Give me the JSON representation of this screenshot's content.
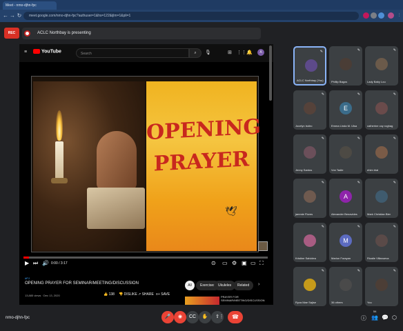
{
  "browser": {
    "tab_title": "Meet - nmo-djhn-fpc",
    "url": "meet.google.com/nmo-djhn-fpc?authuser=1&hs=122&ijlm=1&pli=1",
    "nav_back": "←",
    "nav_forward": "→",
    "reload": "↻"
  },
  "meet": {
    "rec_label": "REC",
    "presenting_text": "ACLC Northbay is presenting",
    "meeting_code": "nmo-djhn-fpc"
  },
  "youtube": {
    "brand": "YouTube",
    "search_placeholder": "Search",
    "video_title_art": "OPENING PRAYER",
    "timecode": "0:00 / 3:17",
    "tag": "#PJ",
    "title": "OPENING PRAYER FOR SEMINAR/MEETING/DISCUSSION",
    "meta": "13,885 views · Dec 13, 2020",
    "likes": "138",
    "dislike": "DISLIKE",
    "share": "SHARE",
    "save": "SAVE",
    "chips": [
      "All",
      "Exercises",
      "Ukuleles",
      "Related"
    ],
    "rec_title": "PRAYER FOR SEMINAR/MEETING/DISCUSSION"
  },
  "participants": [
    {
      "name": "ACLC Northbay (You)",
      "initial": "",
      "color": "#5d4a8a"
    },
    {
      "name": "Phillip Bagos",
      "initial": "",
      "color": "#4a3d36"
    },
    {
      "name": "Lady Baby Lou",
      "initial": "",
      "color": "#6b5a4a"
    },
    {
      "name": "Jocelyn Isidro",
      "initial": "",
      "color": "#55423a"
    },
    {
      "name": "Emma Linda M. Ulsa",
      "initial": "E",
      "color": "#3b6c8a"
    },
    {
      "name": "catherine coy roghag",
      "initial": "",
      "color": "#6a4b4b"
    },
    {
      "name": "Jenny Santos",
      "initial": "",
      "color": "#6b4f5a"
    },
    {
      "name": "Von Tadle",
      "initial": "",
      "color": "#4d4a44"
    },
    {
      "name": "ehim trial",
      "initial": "",
      "color": "#7a5b47"
    },
    {
      "name": "jammie Flores",
      "initial": "",
      "color": "#6f5a4f"
    },
    {
      "name": "Alexander Benavides",
      "initial": "A",
      "color": "#8e24aa"
    },
    {
      "name": "Mark Christian Bier",
      "initial": "",
      "color": "#3f5b6e"
    },
    {
      "name": "Kristine Salvidea",
      "initial": "",
      "color": "#a85c82"
    },
    {
      "name": "Marlon Furayan",
      "initial": "M",
      "color": "#5c6bc0"
    },
    {
      "name": "Rizalie Villanueva",
      "initial": "",
      "color": "#5a4a48"
    },
    {
      "name": "Ryza Mae Sajise",
      "initial": "",
      "color": "#c59a1a"
    },
    {
      "name": "36 others",
      "initial": "",
      "color": "#4a4a4a"
    },
    {
      "name": "You",
      "initial": "",
      "color": "#4c3e36"
    }
  ],
  "colors": {
    "accent_blue": "#8ab4f8",
    "end_call_red": "#ea4335",
    "youtube_red": "#ff0000"
  }
}
